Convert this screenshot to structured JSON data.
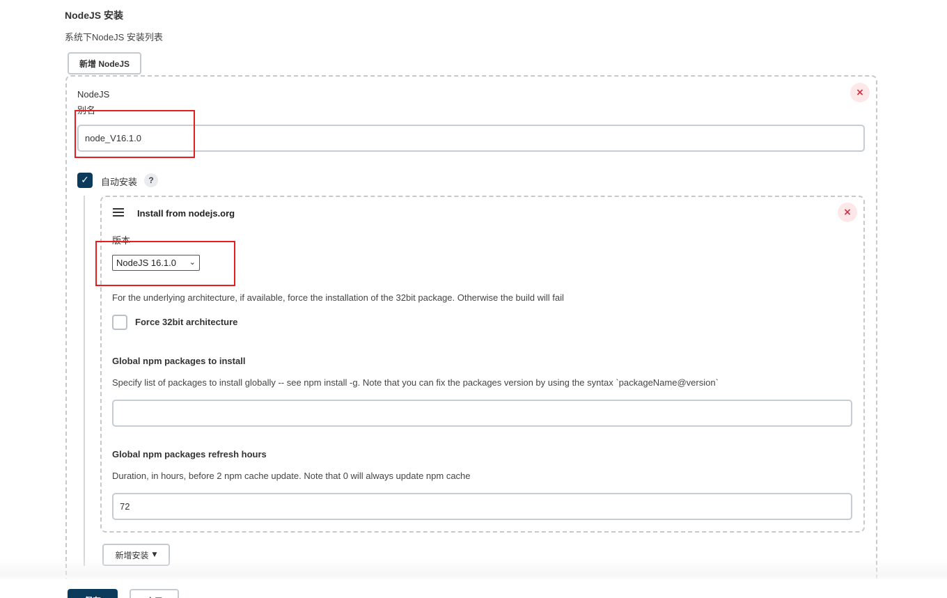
{
  "section": {
    "title": "NodeJS 安装",
    "description": "系统下NodeJS 安装列表",
    "add_button": "新增 NodeJS"
  },
  "nodejs_entry": {
    "type_label": "NodeJS",
    "alias_label": "别名",
    "alias_value": "node_V16.1.0",
    "close_symbol": "×",
    "auto_install": {
      "checked": true,
      "check_symbol": "✓",
      "label": "自动安装",
      "help_symbol": "?"
    },
    "installer": {
      "title": "Install from nodejs.org",
      "close_symbol": "×",
      "version_label": "版本",
      "version_selected": "NodeJS 16.1.0",
      "arch_description": "For the underlying architecture, if available, force the installation of the 32bit package. Otherwise the build will fail",
      "force32_label": "Force 32bit architecture",
      "force32_checked": false,
      "npm_packages_title": "Global npm packages to install",
      "npm_packages_description": "Specify list of packages to install globally -- see npm install -g. Note that you can fix the packages version by using the syntax `packageName@version`",
      "npm_packages_value": "",
      "refresh_title": "Global npm packages refresh hours",
      "refresh_description": "Duration, in hours, before 2 npm cache update. Note that 0 will always update npm cache",
      "refresh_value": "72"
    },
    "add_installer_button": "新增安装",
    "add_installer_caret": "▼"
  },
  "footer": {
    "save_label": "保存",
    "apply_label": "应用"
  },
  "colors": {
    "primary": "#0b3a5a",
    "close_bg": "#fde7e9",
    "close_fg": "#d42a3b",
    "highlight": "#e41e1e"
  },
  "icons": {
    "drag_handle": "drag-handle-icon",
    "close": "close-icon",
    "help": "help-icon",
    "dropdown": "chevron-down-icon"
  }
}
